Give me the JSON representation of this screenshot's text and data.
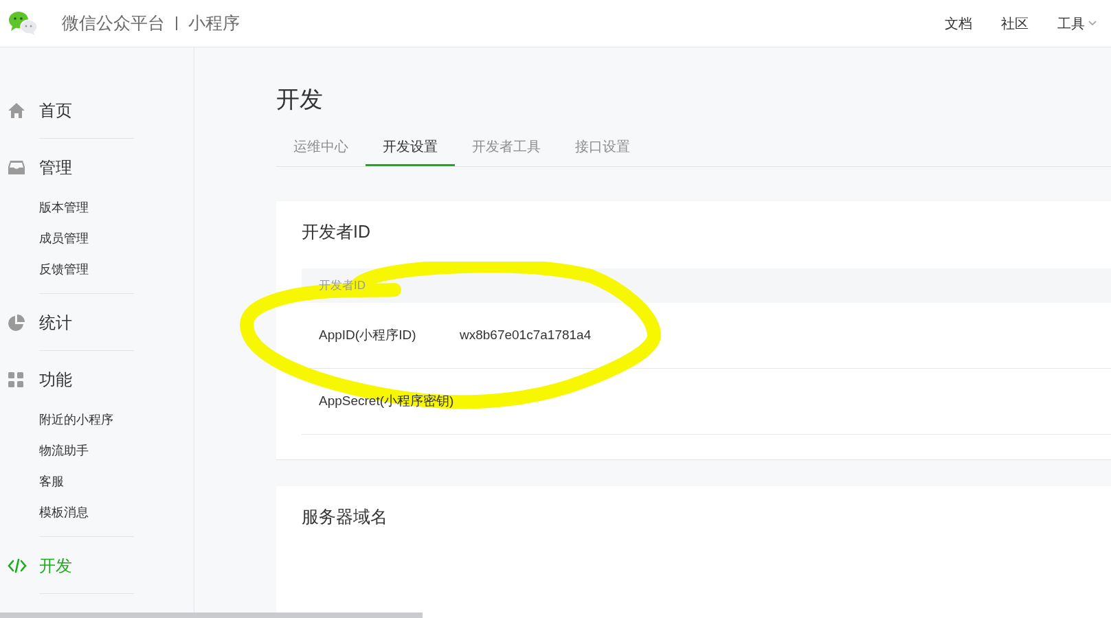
{
  "header": {
    "brand": "微信公众平台",
    "product": "小程序",
    "links": [
      {
        "label": "文档",
        "has_menu": false
      },
      {
        "label": "社区",
        "has_menu": false
      },
      {
        "label": "工具",
        "has_menu": true
      }
    ]
  },
  "sidebar": {
    "sections": [
      {
        "label": "首页",
        "selected": false
      },
      {
        "label": "管理",
        "selected": false,
        "children": [
          {
            "label": "版本管理"
          },
          {
            "label": "成员管理"
          },
          {
            "label": "反馈管理"
          }
        ]
      },
      {
        "label": "统计",
        "selected": false
      },
      {
        "label": "功能",
        "selected": false,
        "children": [
          {
            "label": "附近的小程序"
          },
          {
            "label": "物流助手"
          },
          {
            "label": "客服"
          },
          {
            "label": "模板消息"
          }
        ]
      },
      {
        "label": "开发",
        "selected": true
      }
    ]
  },
  "page_title": "开发",
  "tabs": [
    {
      "label": "运维中心",
      "selected": false
    },
    {
      "label": "开发设置",
      "selected": true
    },
    {
      "label": "开发者工具",
      "selected": false
    },
    {
      "label": "接口设置",
      "selected": false
    }
  ],
  "developer_id_card": {
    "title": "开发者ID",
    "table_header": "开发者ID",
    "rows": [
      {
        "label": "AppID(小程序ID)",
        "value": "wx8b67e01c7a1781a4"
      },
      {
        "label": "AppSecret(小程序密钥)"
      }
    ]
  },
  "server_domain_card": {
    "title": "服务器域名"
  }
}
